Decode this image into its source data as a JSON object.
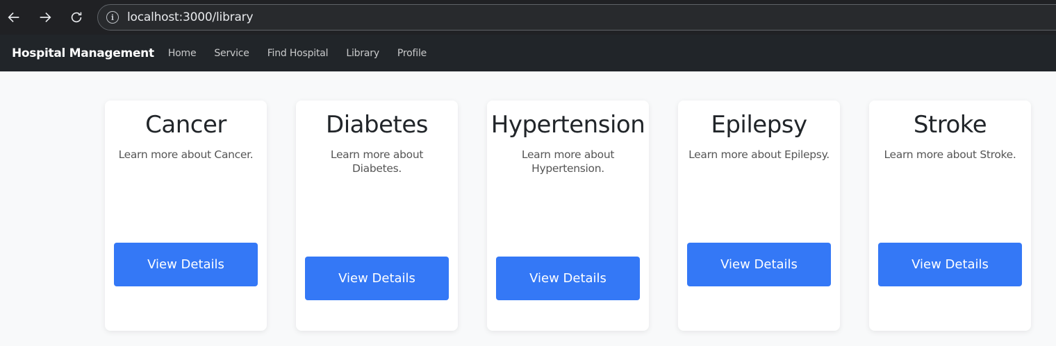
{
  "browser": {
    "url": "localhost:3000/library"
  },
  "navbar": {
    "brand": "Hospital Management",
    "links": [
      "Home",
      "Service",
      "Find Hospital",
      "Library",
      "Profile"
    ]
  },
  "cards": [
    {
      "title": "Cancer",
      "description": "Learn more about Cancer.",
      "button": "View Details"
    },
    {
      "title": "Diabetes",
      "description": "Learn more about Diabetes.",
      "button": "View Details"
    },
    {
      "title": "Hypertension",
      "description": "Learn more about Hypertension.",
      "button": "View Details"
    },
    {
      "title": "Epilepsy",
      "description": "Learn more about Epilepsy.",
      "button": "View Details"
    },
    {
      "title": "Stroke",
      "description": "Learn more about Stroke.",
      "button": "View Details"
    }
  ],
  "colors": {
    "primary_button": "#3478f6",
    "navbar_bg": "#212529",
    "page_bg": "#f8f9fa"
  }
}
